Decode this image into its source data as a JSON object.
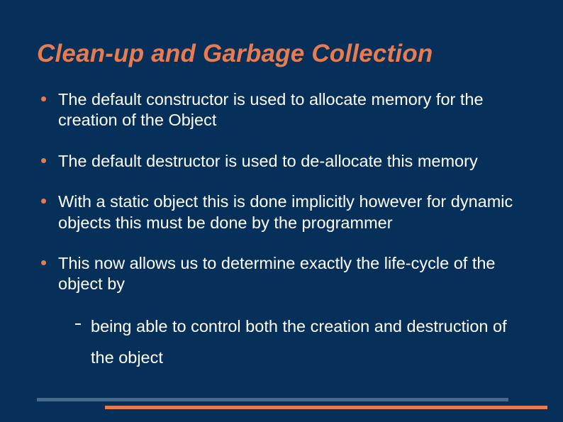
{
  "slide": {
    "title": "Clean-up and Garbage Collection",
    "bullets": [
      {
        "text": "The default constructor is used to allocate memory for the creation of the Object"
      },
      {
        "text": "The default destructor is used to de-allocate this memory"
      },
      {
        "text": "With a static object this is done implicitly however for dynamic objects this must be done by the programmer"
      },
      {
        "text": "This now allows us to determine exactly the life-cycle of the object by",
        "sub": [
          {
            "text": "being able to control both the creation and destruction of the object"
          }
        ]
      }
    ]
  },
  "colors": {
    "background": "#06305a",
    "accent": "#e87b4f",
    "text": "#ffffff",
    "bar_muted": "#4a6a8a"
  }
}
